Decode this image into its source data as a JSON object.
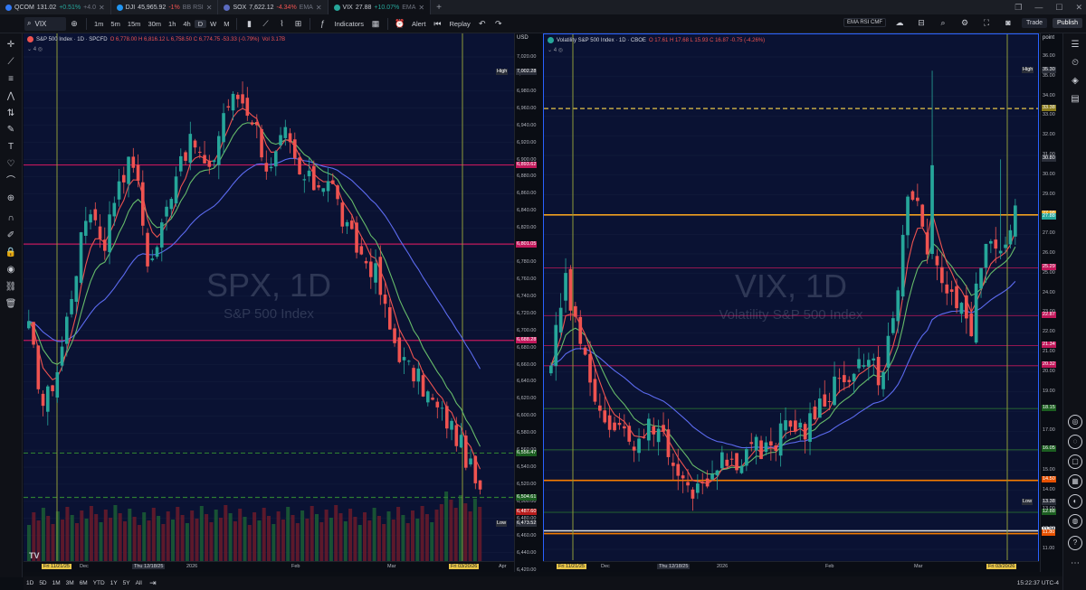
{
  "tabs": [
    {
      "symbol": "QCOM",
      "price": "131.02",
      "change": "+0.51%",
      "extra": "+4.0",
      "color": "#3179f5",
      "change_color": "#26a69a"
    },
    {
      "symbol": "DJI",
      "price": "45,965.92",
      "change": "-1%",
      "extra": "BB RSI",
      "color": "#2196f3",
      "change_color": "#ef5350"
    },
    {
      "symbol": "SOX",
      "price": "7,622.12",
      "change": "-4.34%",
      "extra": "EMA",
      "color": "#5b6bc0",
      "change_color": "#ef5350"
    },
    {
      "symbol": "VIX",
      "price": "27.88",
      "change": "+10.07%",
      "extra": "EMA",
      "color": "#26a69a",
      "change_color": "#26a69a"
    }
  ],
  "toolbar": {
    "symbol": "VIX",
    "intervals": [
      "1m",
      "5m",
      "15m",
      "30m",
      "1h",
      "4h",
      "D",
      "W",
      "M"
    ],
    "selected_interval": "D",
    "indicators_label": "Indicators",
    "alert_label": "Alert",
    "replay_label": "Replay",
    "indicator_template": "EMA RSI CMF",
    "trade_label": "Trade",
    "publish_label": "Publish"
  },
  "spx": {
    "title": "S&P 500 Index · 1D · SPCFD",
    "ohlc": "O 6,778.00  H 6,816.12  L 6,758.50  C 6,774.75  -53.33 (-0.79%)",
    "vol": "Vol 3.17B",
    "sub_count": "4",
    "watermark": "SPX, 1D",
    "watermark_sub": "S&P 500 Index",
    "currency": "USD",
    "y_ticks": [
      "7,020.00",
      "7,000.00",
      "6,980.00",
      "6,960.00",
      "6,940.00",
      "6,920.00",
      "6,900.00",
      "6,880.00",
      "6,860.00",
      "6,840.00",
      "6,820.00",
      "6,800.00",
      "6,780.00",
      "6,760.00",
      "6,740.00",
      "6,720.00",
      "6,700.00",
      "6,680.00",
      "6,660.00",
      "6,640.00",
      "6,620.00",
      "6,600.00",
      "6,580.00",
      "6,560.00",
      "6,540.00",
      "6,520.00",
      "6,500.00",
      "6,480.00",
      "6,460.00",
      "6,440.00",
      "6,420.00"
    ],
    "price_labels": [
      {
        "text": "7,002.28",
        "tag": "High",
        "color": "#2a2e39"
      },
      {
        "text": "6,893.62",
        "tag": "",
        "color": "#c2185b"
      },
      {
        "text": "6,801.05",
        "tag": "",
        "color": "#c2185b"
      },
      {
        "text": "6,688.28",
        "tag": "",
        "color": "#c2185b"
      },
      {
        "text": "6,556.47",
        "tag": "",
        "color": "#1b5e20"
      },
      {
        "text": "6,504.61",
        "tag": "",
        "color": "#1b5e20"
      },
      {
        "text": "6,487.60",
        "tag": "",
        "color": "#b71c1c"
      },
      {
        "text": "6,473.52",
        "tag": "Low",
        "color": "#2a2e39"
      }
    ],
    "time_labels": [
      "Fri 11/21/25",
      "Dec",
      "Thu 12/18/25",
      "2026",
      "Feb",
      "Mar",
      "Fri 03/20/26",
      "Apr"
    ]
  },
  "vix": {
    "title": "Volatility S&P 500 Index · 1D · CBOE",
    "ohlc": "O 17.61  H 17.68  L 15.93  C 16.87  -0.75 (-4.26%)",
    "sub_count": "4",
    "watermark": "VIX, 1D",
    "watermark_sub": "Volatility S&P 500 Index",
    "scale_mode": "point",
    "y_ticks": [
      "36.00",
      "35.00",
      "34.00",
      "33.00",
      "32.00",
      "31.00",
      "30.00",
      "29.00",
      "28.00",
      "27.00",
      "26.00",
      "25.00",
      "24.00",
      "23.00",
      "22.00",
      "21.00",
      "20.00",
      "19.00",
      "18.00",
      "17.00",
      "16.00",
      "15.00",
      "14.00",
      "13.00",
      "12.00",
      "11.00"
    ],
    "price_labels": [
      {
        "text": "35.30",
        "tag": "High",
        "color": "#2a2e39"
      },
      {
        "text": "33.38",
        "tag": "",
        "color": "#8a7b1d"
      },
      {
        "text": "30.80",
        "tag": "",
        "color": "#2a2e39"
      },
      {
        "text": "27.98",
        "tag": "",
        "color": "#e0a11b"
      },
      {
        "text": "27.88",
        "tag": "",
        "color": "#26a69a"
      },
      {
        "text": "25.29",
        "tag": "",
        "color": "#c2185b"
      },
      {
        "text": "22.87",
        "tag": "",
        "color": "#c2185b"
      },
      {
        "text": "21.34",
        "tag": "",
        "color": "#c2185b"
      },
      {
        "text": "20.32",
        "tag": "",
        "color": "#c2185b"
      },
      {
        "text": "18.15",
        "tag": "",
        "color": "#1b5e20"
      },
      {
        "text": "16.05",
        "tag": "",
        "color": "#1b5e20"
      },
      {
        "text": "14.50",
        "tag": "",
        "color": "#e65100"
      },
      {
        "text": "13.38",
        "tag": "Low",
        "color": "#2a2e39"
      },
      {
        "text": "12.88",
        "tag": "",
        "color": "#1b5e20"
      },
      {
        "text": "11.94",
        "tag": "",
        "color": "#e0e0e0"
      },
      {
        "text": "11.80",
        "tag": "",
        "color": "#e65100"
      }
    ],
    "time_labels": [
      "Fri 11/21/25",
      "Dec",
      "Thu 12/18/25",
      "2026",
      "Feb",
      "Mar",
      "Fri 03/20/26"
    ]
  },
  "bottombar": {
    "ranges": [
      "1D",
      "5D",
      "1M",
      "3M",
      "6M",
      "YTD",
      "1Y",
      "5Y",
      "All"
    ],
    "clock": "15:22:37 UTC-4"
  },
  "colors": {
    "up": "#26a69a",
    "down": "#ef5350",
    "ema_fast": "#ef5350",
    "ema_mid": "#66bb6a",
    "ema_slow": "#5c6bf0"
  }
}
